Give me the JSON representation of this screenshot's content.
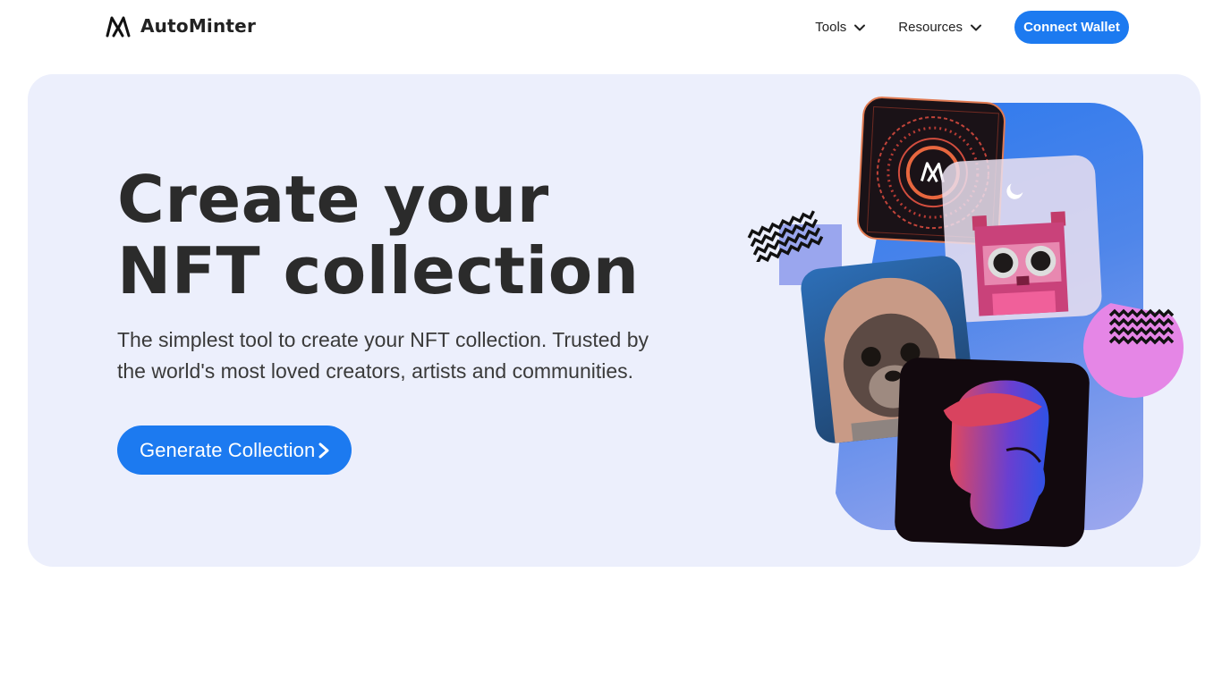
{
  "header": {
    "brand": "AutoMinter",
    "nav": {
      "tools_label": "Tools",
      "resources_label": "Resources"
    },
    "connect_wallet_label": "Connect Wallet"
  },
  "hero": {
    "title": "Create your NFT collection",
    "subtitle": "The simplest tool to create your NFT collection. Trusted by the world's most loved creators, artists and communities.",
    "cta_label": "Generate Collection"
  },
  "colors": {
    "accent": "#1c7af0",
    "hero_bg": "#eceffc",
    "text_dark": "#2b2b2b"
  },
  "icons": {
    "logo": "autominter-logo-icon",
    "tools_chevron": "chevron-down-icon",
    "resources_chevron": "chevron-down-icon",
    "cta_chevron": "chevron-right-icon"
  }
}
